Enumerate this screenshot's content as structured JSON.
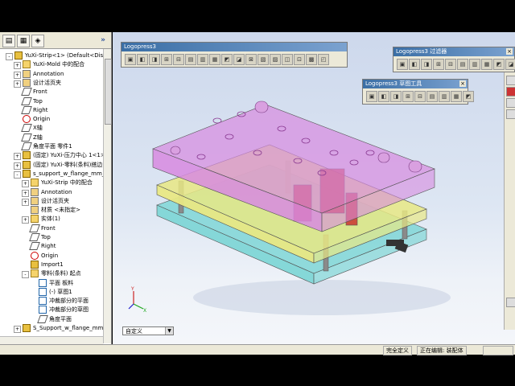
{
  "panel_tabs": [
    "feature-manager",
    "property-manager",
    "configuration-manager"
  ],
  "tree": [
    {
      "label": "YuXi-Strip<1> (Default<Display",
      "icon": "part",
      "indent": 0,
      "expander": "-"
    },
    {
      "label": "YuXi-Mold 中的配合",
      "icon": "folder",
      "indent": 1,
      "expander": "+"
    },
    {
      "label": "Annotation",
      "icon": "note",
      "indent": 1,
      "expander": "+"
    },
    {
      "label": "设计活页夹",
      "icon": "note",
      "indent": 1,
      "expander": "+"
    },
    {
      "label": "Front",
      "icon": "plane",
      "indent": 1,
      "expander": ""
    },
    {
      "label": "Top",
      "icon": "plane",
      "indent": 1,
      "expander": ""
    },
    {
      "label": "Right",
      "icon": "plane",
      "indent": 1,
      "expander": ""
    },
    {
      "label": "Origin",
      "icon": "origin",
      "indent": 1,
      "expander": ""
    },
    {
      "label": "X轴",
      "icon": "plane",
      "indent": 1,
      "expander": ""
    },
    {
      "label": "Z轴",
      "icon": "plane",
      "indent": 1,
      "expander": ""
    },
    {
      "label": "角度平面 零件1",
      "icon": "plane",
      "indent": 1,
      "expander": ""
    },
    {
      "label": "(固定) YuXi-压力中心 1<1>",
      "icon": "part",
      "indent": 1,
      "expander": "+"
    },
    {
      "label": "(固定) YuXi-零料(条料)搭边",
      "icon": "part",
      "indent": 1,
      "expander": "+"
    },
    {
      "label": "s_support_w_flange_mm_fc",
      "icon": "part",
      "indent": 1,
      "expander": "-"
    },
    {
      "label": "YuXi-Strip 中的配合",
      "icon": "folder",
      "indent": 2,
      "expander": "+"
    },
    {
      "label": "Annotation",
      "icon": "note",
      "indent": 2,
      "expander": "+"
    },
    {
      "label": "设计活页夹",
      "icon": "note",
      "indent": 2,
      "expander": "+"
    },
    {
      "label": "材质 <未指定>",
      "icon": "note",
      "indent": 2,
      "expander": ""
    },
    {
      "label": "实体(1)",
      "icon": "folder",
      "indent": 2,
      "expander": "+"
    },
    {
      "label": "Front",
      "icon": "plane",
      "indent": 2,
      "expander": ""
    },
    {
      "label": "Top",
      "icon": "plane",
      "indent": 2,
      "expander": ""
    },
    {
      "label": "Right",
      "icon": "plane",
      "indent": 2,
      "expander": ""
    },
    {
      "label": "Origin",
      "icon": "origin",
      "indent": 2,
      "expander": ""
    },
    {
      "label": "Import1",
      "icon": "part",
      "indent": 2,
      "expander": ""
    },
    {
      "label": "零料(条料) 起点",
      "icon": "folder",
      "indent": 2,
      "expander": "-"
    },
    {
      "label": "平面 板料",
      "icon": "sketch",
      "indent": 3,
      "expander": ""
    },
    {
      "label": "(-) 草图1",
      "icon": "sketch",
      "indent": 3,
      "expander": ""
    },
    {
      "label": "冲裁部分的平面",
      "icon": "sketch",
      "indent": 3,
      "expander": ""
    },
    {
      "label": "冲裁部分的草图",
      "icon": "sketch",
      "indent": 3,
      "expander": ""
    },
    {
      "label": "角度平面",
      "icon": "plane",
      "indent": 3,
      "expander": ""
    },
    {
      "label": "S_Support_w_flange_mm<1",
      "icon": "part",
      "indent": 1,
      "expander": "+"
    }
  ],
  "toolbars": {
    "main": {
      "title": "Logopress3",
      "buttons": 17
    },
    "filter": {
      "title": "Logopress3 过滤器",
      "buttons": 11
    },
    "sketch": {
      "title": "Logopress3 草图工具",
      "buttons": 9
    }
  },
  "config_dropdown": {
    "value": "自定义"
  },
  "status": {
    "defined": "完全定义",
    "editing": "正在编辑: 装配体"
  },
  "colors": {
    "top_plate": "#d78ae0",
    "middle_plate": "#e8e884",
    "bottom_plate": "#7fd6d6",
    "punch_red": "#c82828",
    "toolbar_title": "#3a6ea5"
  }
}
